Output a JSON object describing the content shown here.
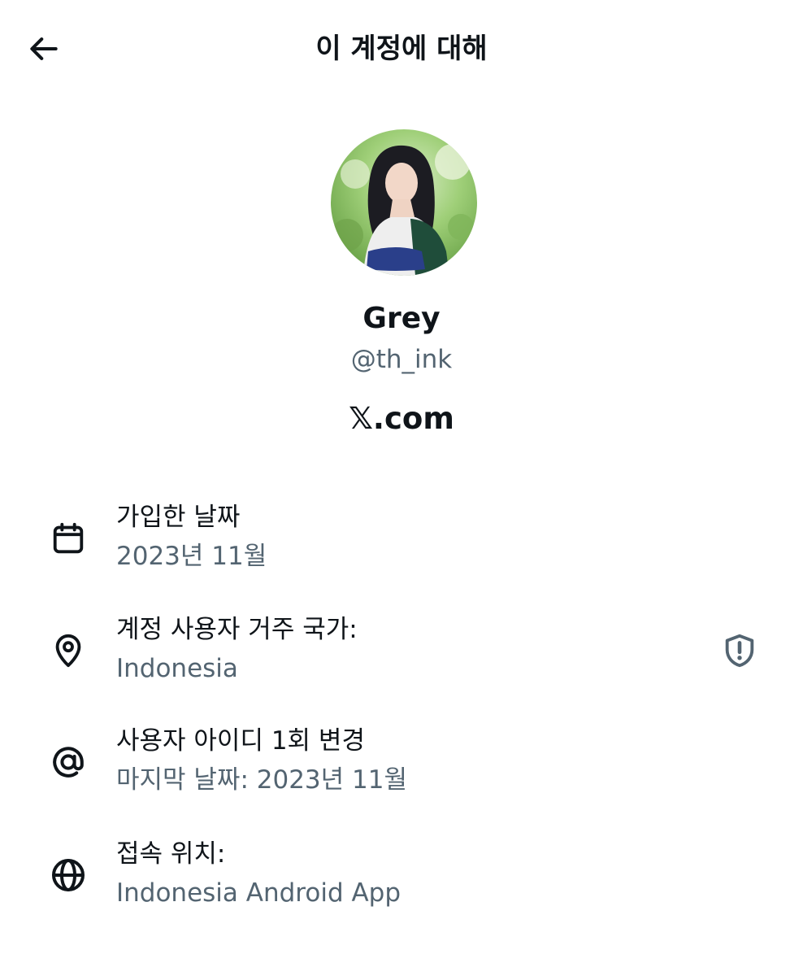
{
  "header": {
    "title": "이 계정에 대해",
    "back_icon": "arrow-left-icon"
  },
  "profile": {
    "display_name": "Grey",
    "handle": "@th_ink",
    "brand": "𝕏.com"
  },
  "rows": [
    {
      "icon": "calendar-icon",
      "title": "가입한 날짜",
      "value": "2023년 11월"
    },
    {
      "icon": "location-pin-icon",
      "title": "계정 사용자 거주 국가:",
      "value": "Indonesia",
      "trailing_icon": "shield-alert-icon"
    },
    {
      "icon": "at-sign-icon",
      "title": "사용자 아이디 1회 변경",
      "value": "마지막 날짜: 2023년 11월"
    },
    {
      "icon": "globe-icon",
      "title": "접속 위치:",
      "value": "Indonesia Android App"
    }
  ],
  "colors": {
    "primary_text": "#0f1419",
    "secondary_text": "#536471",
    "background": "#ffffff"
  }
}
